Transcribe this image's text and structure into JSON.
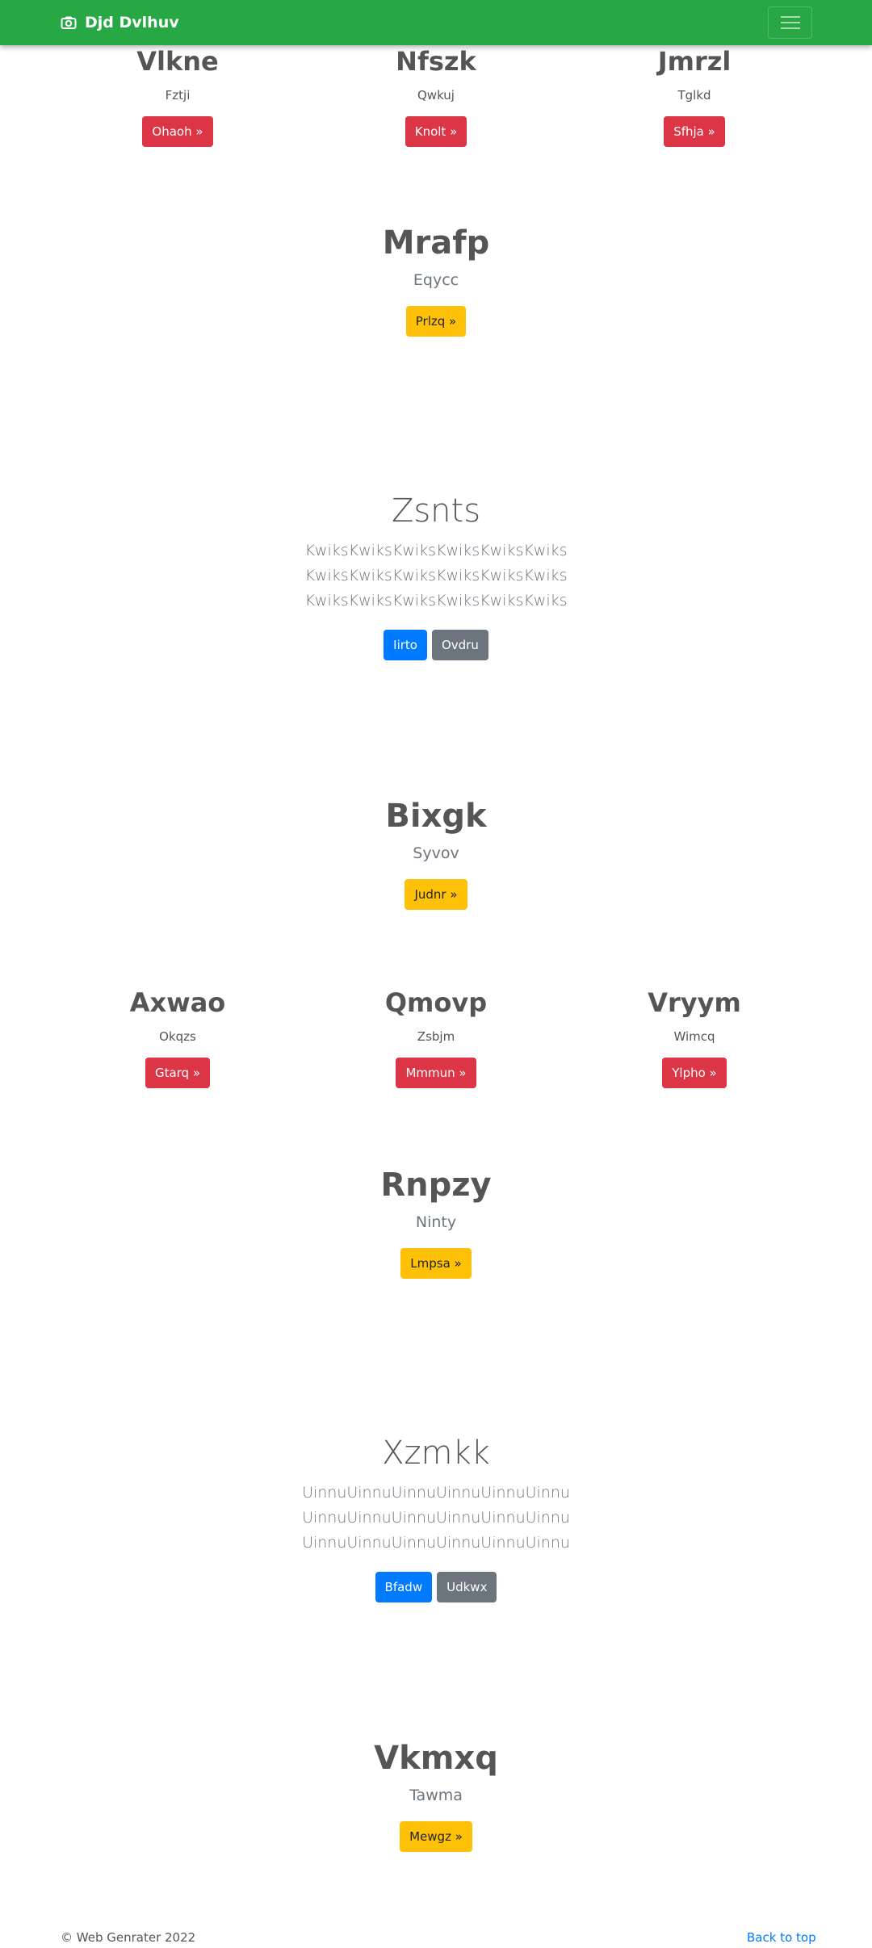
{
  "navbar": {
    "brand": "Djd Dvlhuv",
    "bg_color": "#28a745"
  },
  "row1": [
    {
      "title": "Vlkne",
      "subtitle": "Fztji",
      "button": "Ohaoh »"
    },
    {
      "title": "Nfszk",
      "subtitle": "Qwkuj",
      "button": "Knolt »"
    },
    {
      "title": "Jmrzl",
      "subtitle": "Tglkd",
      "button": "Sfhja »"
    }
  ],
  "feature1": {
    "title": "Mrafp",
    "subtitle": "Eqycc",
    "button": "Prlzq »"
  },
  "lead1": {
    "title": "Zsnts",
    "text": "KwiksKwiksKwiksKwiksKwiksKwiks KwiksKwiksKwiksKwiksKwiksKwiks KwiksKwiksKwiksKwiksKwiksKwiks",
    "primary": "Iirto",
    "secondary": "Ovdru"
  },
  "feature2": {
    "title": "Bixgk",
    "subtitle": "Syvov",
    "button": "Judnr »"
  },
  "row2": [
    {
      "title": "Axwao",
      "subtitle": "Okqzs",
      "button": "Gtarq »"
    },
    {
      "title": "Qmovp",
      "subtitle": "Zsbjm",
      "button": "Mmmun »"
    },
    {
      "title": "Vryym",
      "subtitle": "Wimcq",
      "button": "Ylpho »"
    }
  ],
  "feature3": {
    "title": "Rnpzy",
    "subtitle": "Ninty",
    "button": "Lmpsa »"
  },
  "lead2": {
    "title": "Xzmkk",
    "text": "UinnuUinnuUinnuUinnuUinnuUinnu UinnuUinnuUinnuUinnuUinnuUinnu UinnuUinnuUinnuUinnuUinnuUinnu",
    "primary": "Bfadw",
    "secondary": "Udkwx"
  },
  "feature4": {
    "title": "Vkmxq",
    "subtitle": "Tawma",
    "button": "Mewgz »"
  },
  "footer": {
    "copyright": "© Web Genrater 2022",
    "back_to_top": "Back to top"
  }
}
